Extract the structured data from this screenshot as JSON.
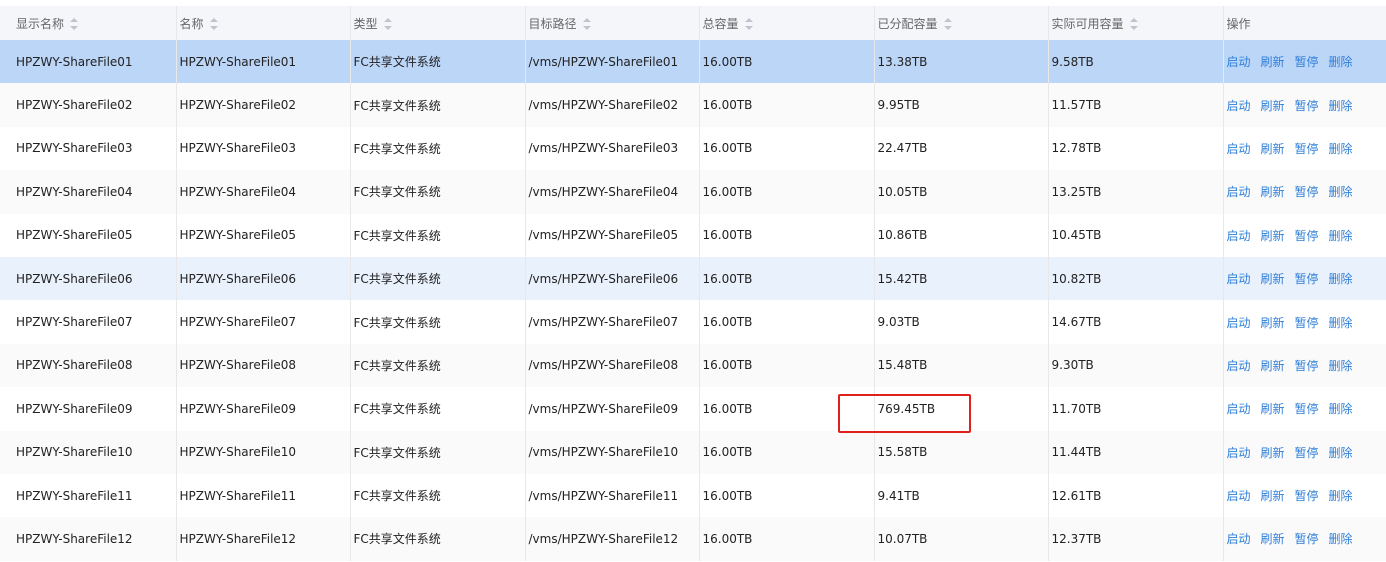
{
  "columns": [
    "显示名称",
    "名称",
    "类型",
    "目标路径",
    "总容量",
    "已分配容量",
    "实际可用容量",
    "操作"
  ],
  "actions": [
    "启动",
    "刷新",
    "暂停",
    "删除"
  ],
  "rows": [
    {
      "display_name": "HPZWY-ShareFile01",
      "name": "HPZWY-ShareFile01",
      "type": "FC共享文件系统",
      "path": "/vms/HPZWY-ShareFile01",
      "total": "16.00TB",
      "allocated": "13.38TB",
      "available": "9.58TB"
    },
    {
      "display_name": "HPZWY-ShareFile02",
      "name": "HPZWY-ShareFile02",
      "type": "FC共享文件系统",
      "path": "/vms/HPZWY-ShareFile02",
      "total": "16.00TB",
      "allocated": "9.95TB",
      "available": "11.57TB"
    },
    {
      "display_name": "HPZWY-ShareFile03",
      "name": "HPZWY-ShareFile03",
      "type": "FC共享文件系统",
      "path": "/vms/HPZWY-ShareFile03",
      "total": "16.00TB",
      "allocated": "22.47TB",
      "available": "12.78TB"
    },
    {
      "display_name": "HPZWY-ShareFile04",
      "name": "HPZWY-ShareFile04",
      "type": "FC共享文件系统",
      "path": "/vms/HPZWY-ShareFile04",
      "total": "16.00TB",
      "allocated": "10.05TB",
      "available": "13.25TB"
    },
    {
      "display_name": "HPZWY-ShareFile05",
      "name": "HPZWY-ShareFile05",
      "type": "FC共享文件系统",
      "path": "/vms/HPZWY-ShareFile05",
      "total": "16.00TB",
      "allocated": "10.86TB",
      "available": "10.45TB"
    },
    {
      "display_name": "HPZWY-ShareFile06",
      "name": "HPZWY-ShareFile06",
      "type": "FC共享文件系统",
      "path": "/vms/HPZWY-ShareFile06",
      "total": "16.00TB",
      "allocated": "15.42TB",
      "available": "10.82TB"
    },
    {
      "display_name": "HPZWY-ShareFile07",
      "name": "HPZWY-ShareFile07",
      "type": "FC共享文件系统",
      "path": "/vms/HPZWY-ShareFile07",
      "total": "16.00TB",
      "allocated": "9.03TB",
      "available": "14.67TB"
    },
    {
      "display_name": "HPZWY-ShareFile08",
      "name": "HPZWY-ShareFile08",
      "type": "FC共享文件系统",
      "path": "/vms/HPZWY-ShareFile08",
      "total": "16.00TB",
      "allocated": "15.48TB",
      "available": "9.30TB"
    },
    {
      "display_name": "HPZWY-ShareFile09",
      "name": "HPZWY-ShareFile09",
      "type": "FC共享文件系统",
      "path": "/vms/HPZWY-ShareFile09",
      "total": "16.00TB",
      "allocated": "769.45TB",
      "available": "11.70TB"
    },
    {
      "display_name": "HPZWY-ShareFile10",
      "name": "HPZWY-ShareFile10",
      "type": "FC共享文件系统",
      "path": "/vms/HPZWY-ShareFile10",
      "total": "16.00TB",
      "allocated": "15.58TB",
      "available": "11.44TB"
    },
    {
      "display_name": "HPZWY-ShareFile11",
      "name": "HPZWY-ShareFile11",
      "type": "FC共享文件系统",
      "path": "/vms/HPZWY-ShareFile11",
      "total": "16.00TB",
      "allocated": "9.41TB",
      "available": "12.61TB"
    },
    {
      "display_name": "HPZWY-ShareFile12",
      "name": "HPZWY-ShareFile12",
      "type": "FC共享文件系统",
      "path": "/vms/HPZWY-ShareFile12",
      "total": "16.00TB",
      "allocated": "10.07TB",
      "available": "12.37TB"
    }
  ],
  "selected_row": 0,
  "hover_row": 5,
  "highlighted_row": 8,
  "colors": {
    "selected_row": "#bcd6f8",
    "hover_row": "#e9f1fc",
    "link": "#2f7fd8",
    "highlight_border": "#e0201a",
    "header_bg": "#f4f6f9"
  }
}
